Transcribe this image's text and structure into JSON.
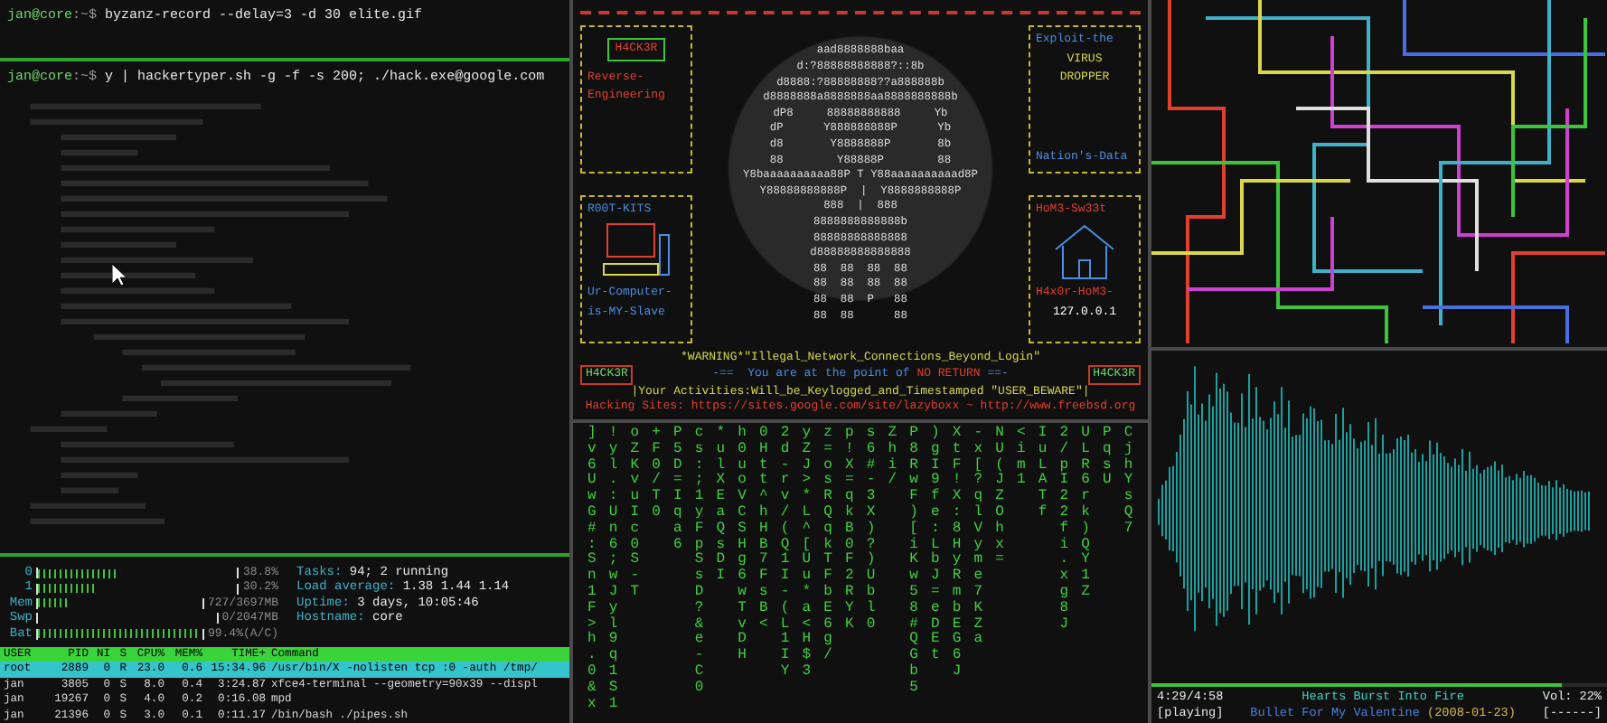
{
  "terminal": {
    "commands": [
      {
        "user": "jan@core",
        "path": ":~$",
        "command": "byzanz-record --delay=3 -d 30 elite.gif"
      },
      {
        "user": "jan@core",
        "path": ":~$",
        "command": "y | hackertyper.sh -g -f -s 200; ./hack.exe@google.com"
      }
    ]
  },
  "htop": {
    "meters": [
      {
        "label": "0",
        "level": 0.39,
        "reading": "38.8%"
      },
      {
        "label": "1",
        "level": 0.3,
        "reading": "30.2%"
      },
      {
        "label": "Mem",
        "level": 0.2,
        "reading": "727/3697MB"
      },
      {
        "label": "Swp",
        "level": 0,
        "reading": "0/2047MB"
      },
      {
        "label": "Bat",
        "level": 0.99,
        "reading": "99.4%(A/C)"
      }
    ],
    "info": [
      {
        "label": "Tasks:",
        "value": "94; 2 running"
      },
      {
        "label": "Load average:",
        "value": "1.38 1.44 1.14"
      },
      {
        "label": "Uptime:",
        "value": "3 days, 10:05:46"
      },
      {
        "label": "Hostname:",
        "value": "core"
      }
    ],
    "columns": [
      "USER",
      "PID",
      "NI",
      "S",
      "CPU%",
      "MEM%",
      "TIME+",
      "Command"
    ],
    "rows": [
      {
        "selected": true,
        "cells": [
          "root",
          "2889",
          "0",
          "R",
          "23.0",
          "0.6",
          "15:34.96",
          "/usr/bin/X -nolisten tcp :0 -auth /tmp/"
        ]
      },
      {
        "selected": false,
        "cells": [
          "jan",
          "3805",
          "0",
          "S",
          "8.0",
          "0.4",
          "3:24.87",
          "xfce4-terminal --geometry=90x39 --displ"
        ]
      },
      {
        "selected": false,
        "cells": [
          "jan",
          "19267",
          "0",
          "S",
          "4.0",
          "0.2",
          "0:16.08",
          "mpd"
        ]
      },
      {
        "selected": false,
        "cells": [
          "jan",
          "21396",
          "0",
          "S",
          "3.0",
          "0.1",
          "0:11.17",
          "/bin/bash ./pipes.sh"
        ]
      }
    ]
  },
  "banner": {
    "left_top": {
      "badge": "H4CK3R",
      "lines": [
        "Reverse-",
        "Engineering"
      ]
    },
    "left_bottom": {
      "title": "R00T-KITS",
      "lines": [
        "Ur-Computer-",
        "is-MY-Slave"
      ]
    },
    "right_top": {
      "title": "Exploit-the",
      "lines": [
        "VIRUS",
        "DROPPER"
      ],
      "footer": "Nation's-Data"
    },
    "right_bottom": {
      "title": "HoM3-Sw33t",
      "lines": [
        "H4x0r-HoM3-"
      ],
      "footer": "127.0.0.1"
    },
    "skull": [
      "aad8888888baa",
      "d:?88888888888?::8b",
      "d8888:?88888888??a888888b",
      "d8888888a8888888aa8888888888b",
      "dP8     88888888888     Yb",
      "dP      Y888888888P      Yb",
      "d8       Y8888888P       8b",
      "88        Y88888P        88",
      "Y8baaaaaaaaaa88P T Y88aaaaaaaaaad8P",
      "Y88888888888P  |  Y8888888888P",
      "888  |  888",
      "8888888888888b",
      "88888888888888",
      "d88888888888888",
      "88  88  88  88",
      "88  88  88  88",
      "88  88  P   88",
      "88  88      88"
    ],
    "warning": "*WARNING*\"Illegal_Network_Connections_Beyond_Login\"",
    "side_badges": [
      "H4CK3R",
      "H4CK3R"
    ],
    "notice": {
      "before": "-==  You are at the point of",
      "emphasis": "NO RETURN",
      "after": "==-"
    },
    "activities": "|Your Activities:Will_be_Keylogged_and_Timestamped \"USER_BEWARE\"|",
    "sites": "Hacking Sites: https://sites.google.com/site/lazyboxx ~ http://www.freebsd.org"
  },
  "matrix": [
    "]v6UwG#:Sn1F>h.0&x",
    "!yl.:Un6;wJyl9q1S1",
    "oZKvuIc0S-T",
    "+F0/T0",
    "P5D=Iqa6",
    "cs:;1yFpSsD?&e-C0",
    "*ulXEaQsDI",
    "h0uoVCSHg6wTvDH",
    "0Htt^hHB7FsB<",
    "2d-rv/(Q1I-(L1IY",
    "yZJ>*L^[Uu*a<H$3",
    "z=osRQqkTFbE6g/",
    "p!X=qkB0F2RYK",
    "s6#-3X)?)Ubl0",
    "Zhi/",
    "P8RwF)[iKw58#QGb5",
    ")gI9fe:LbJ=eDEt",
    "XtF!X:8HyRmbEG6J",
    "-x[?qlVyme7KZa",
    "NU(JZOhx=",
    "<im1",
    "IuLATf",
    "2/pI22fi.xg8J",
    "ULR6rk)QY1Z",
    "PqsU",
    "CjhYsQ7"
  ],
  "player": {
    "elapsed": "4:29/4:58",
    "title": "Hearts Burst Into Fire",
    "volume": "Vol: 22%",
    "state": "[playing]",
    "artist": "Bullet For My Valentine",
    "date": "(2008-01-23)",
    "flags": "[------]",
    "level": 0.9
  }
}
